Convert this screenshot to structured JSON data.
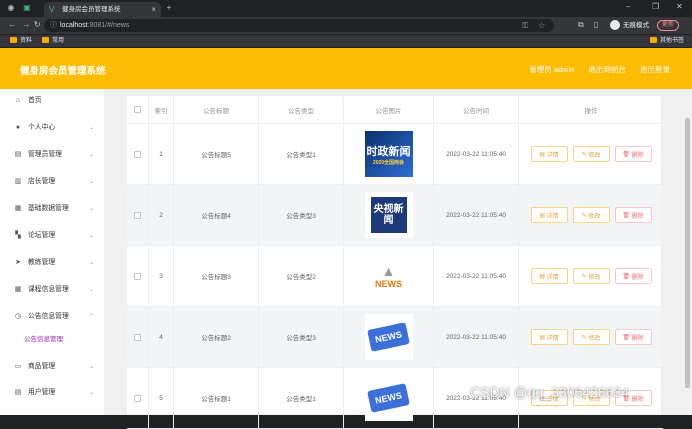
{
  "browser": {
    "tab_title": "健身房会员管理系统",
    "address_host": "localhost",
    "address_path": ":8081/#/news",
    "incognito_label": "无痕模式",
    "update_label": "更新",
    "bookmarks": [
      "资料",
      "常用"
    ],
    "other_bookmarks": "其他书签"
  },
  "header": {
    "title": "健身房会员管理系统",
    "admin_label": "管理员 admin",
    "back_label": "退出到前台",
    "logout_label": "退出登录"
  },
  "sidebar": {
    "items": [
      {
        "label": "首页",
        "icon": "home-icon"
      },
      {
        "label": "个人中心",
        "icon": "user-icon"
      },
      {
        "label": "管理员管理",
        "icon": "admin-icon"
      },
      {
        "label": "店长管理",
        "icon": "manager-icon"
      },
      {
        "label": "基础数据管理",
        "icon": "data-icon"
      },
      {
        "label": "论坛管理",
        "icon": "forum-icon"
      },
      {
        "label": "教练管理",
        "icon": "coach-icon"
      },
      {
        "label": "课程信息管理",
        "icon": "course-icon"
      },
      {
        "label": "公告信息管理",
        "icon": "notice-icon"
      },
      {
        "label": "商品管理",
        "icon": "goods-icon"
      },
      {
        "label": "用户管理",
        "icon": "users-icon"
      }
    ],
    "sub_item": "公告信息管理"
  },
  "table": {
    "columns": [
      "索引",
      "公告标题",
      "公告类型",
      "公告图片",
      "公告时间",
      "操作"
    ],
    "rows": [
      {
        "index": "1",
        "title": "公告标题5",
        "type": "公告类型1",
        "time": "2022-03-22 11:05:40",
        "image": "时政新闻"
      },
      {
        "index": "2",
        "title": "公告标题4",
        "type": "公告类型3",
        "time": "2022-03-22 11:05:40",
        "image": "央视新闻"
      },
      {
        "index": "3",
        "title": "公告标题3",
        "type": "公告类型2",
        "time": "2022-03-22 11:05:40",
        "image": "NEWS"
      },
      {
        "index": "4",
        "title": "公告标题2",
        "type": "公告类型3",
        "time": "2022-03-22 11:05:40",
        "image": "NEWS"
      },
      {
        "index": "5",
        "title": "公告标题1",
        "type": "公告类型1",
        "time": "2022-03-22 11:05:40",
        "image": "NEWS"
      }
    ],
    "actions": {
      "detail": "详情",
      "edit": "修改",
      "delete": "删除"
    }
  },
  "watermark": "CSDN @qq_3306428634",
  "colors": {
    "header": "#fcbc03",
    "accent": "#e6a23c",
    "danger": "#f56c6c",
    "submenu": "#9c27b0"
  }
}
